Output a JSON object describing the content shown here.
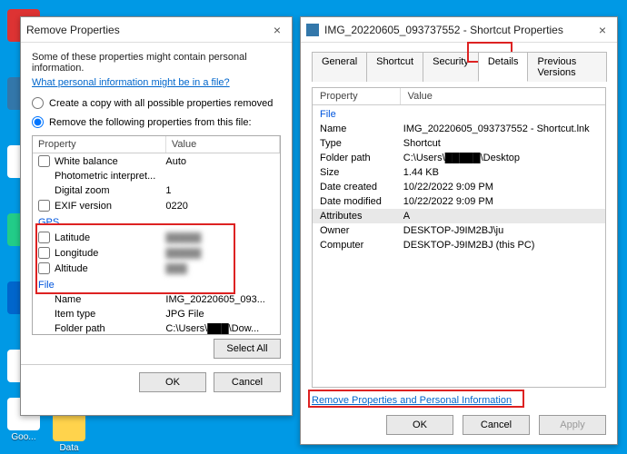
{
  "desktop_labels": [
    "Data",
    "Goo..."
  ],
  "remove": {
    "title": "Remove Properties",
    "desc": "Some of these properties might contain personal information.",
    "help_link": "What personal information might be in a file?",
    "radio_copy": "Create a copy with all possible properties removed",
    "radio_remove": "Remove the following properties from this file:",
    "col_prop": "Property",
    "col_val": "Value",
    "rows": [
      {
        "label": "White balance",
        "val": "Auto",
        "cb": true
      },
      {
        "label": "Photometric interpret...",
        "val": ""
      },
      {
        "label": "Digital zoom",
        "val": "1"
      },
      {
        "label": "EXIF version",
        "val": "0220",
        "cb": true
      }
    ],
    "group_gps": "GPS",
    "gps_rows": [
      {
        "label": "Latitude",
        "val": "█████"
      },
      {
        "label": "Longitude",
        "val": "█████"
      },
      {
        "label": "Altitude",
        "val": "███"
      }
    ],
    "group_file": "File",
    "file_rows": [
      {
        "label": "Name",
        "val": "IMG_20220605_093..."
      },
      {
        "label": "Item type",
        "val": "JPG File"
      },
      {
        "label": "Folder path",
        "val": "C:\\Users\\███\\Dow..."
      }
    ],
    "select_all": "Select All",
    "ok": "OK",
    "cancel": "Cancel"
  },
  "props": {
    "title": "IMG_20220605_093737552 - Shortcut Properties",
    "tabs": [
      "General",
      "Shortcut",
      "Security",
      "Details",
      "Previous Versions"
    ],
    "col_prop": "Property",
    "col_val": "Value",
    "group_file": "File",
    "rows": [
      {
        "p": "Name",
        "v": "IMG_20220605_093737552 - Shortcut.lnk"
      },
      {
        "p": "Type",
        "v": "Shortcut"
      },
      {
        "p": "Folder path",
        "v": "C:\\Users\\█████\\Desktop"
      },
      {
        "p": "Size",
        "v": "1.44 KB"
      },
      {
        "p": "Date created",
        "v": "10/22/2022 9:09 PM"
      },
      {
        "p": "Date modified",
        "v": "10/22/2022 9:09 PM"
      },
      {
        "p": "Attributes",
        "v": "A",
        "sel": true
      },
      {
        "p": "Owner",
        "v": "DESKTOP-J9IM2BJ\\ju"
      },
      {
        "p": "Computer",
        "v": "DESKTOP-J9IM2BJ (this PC)"
      }
    ],
    "remove_link": "Remove Properties and Personal Information",
    "ok": "OK",
    "cancel": "Cancel",
    "apply": "Apply"
  }
}
